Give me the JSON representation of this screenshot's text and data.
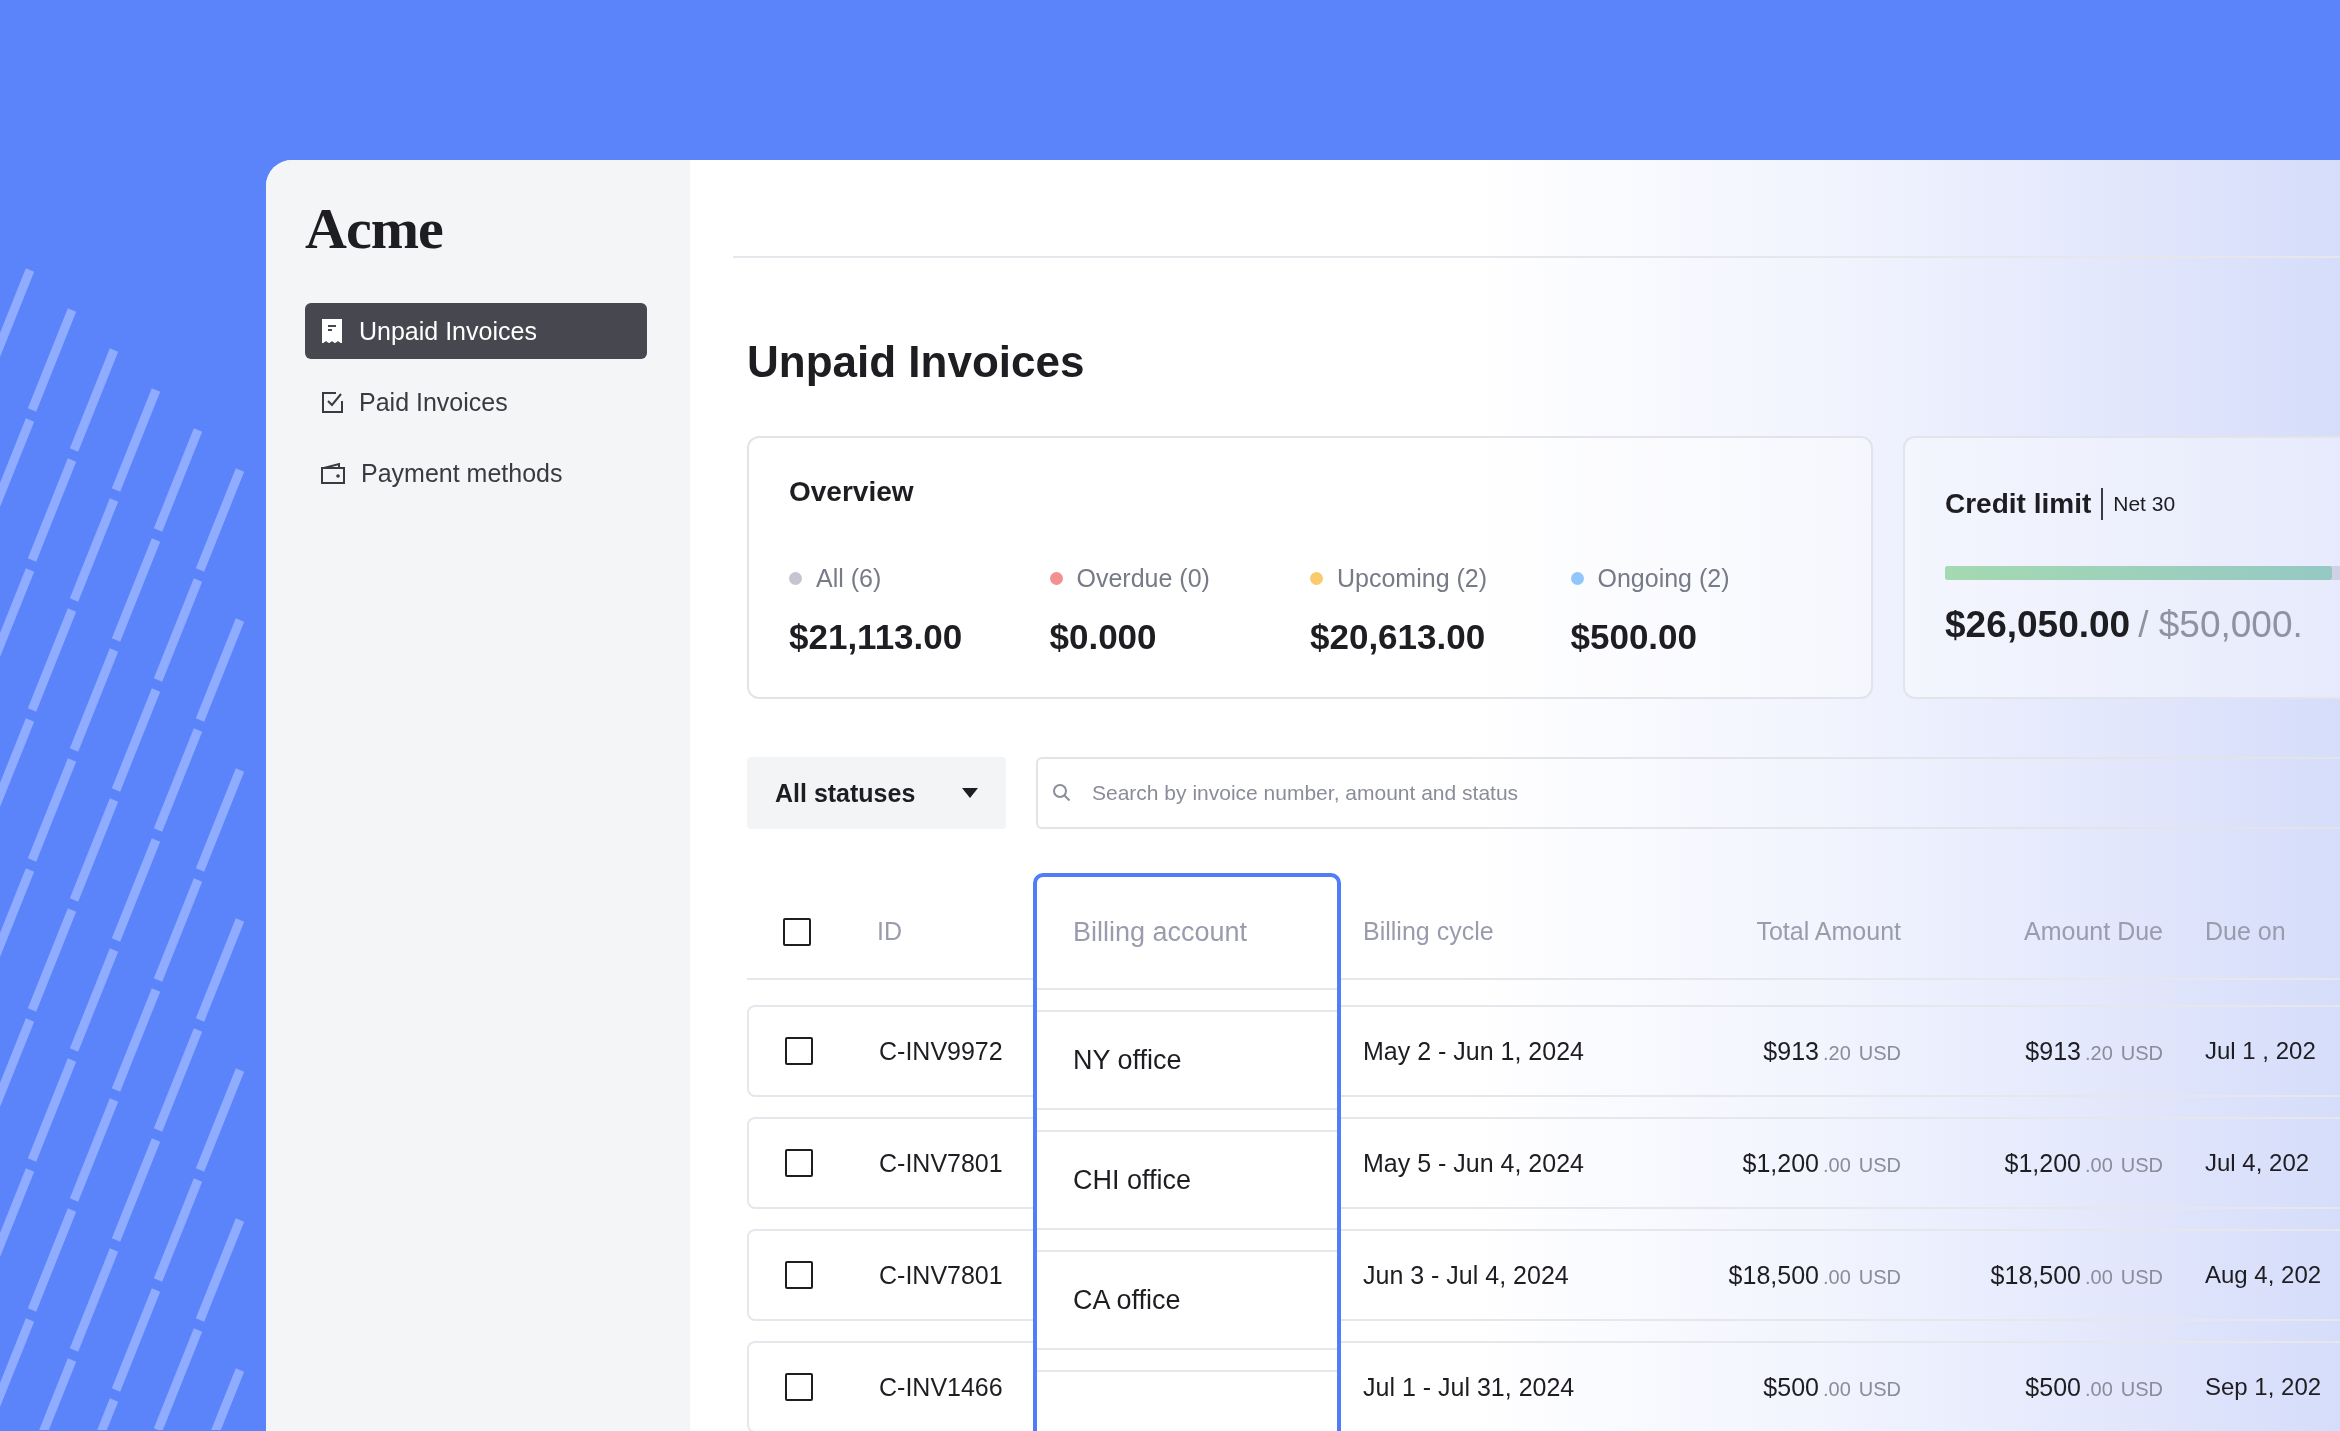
{
  "brand": {
    "name": "Acme"
  },
  "sidebar": {
    "items": [
      {
        "label": "Unpaid Invoices",
        "kind": "receipt",
        "selected": true
      },
      {
        "label": "Paid Invoices",
        "kind": "check",
        "selected": false
      },
      {
        "label": "Payment methods",
        "kind": "wallet",
        "selected": false
      }
    ]
  },
  "page": {
    "title": "Unpaid Invoices"
  },
  "overview": {
    "title": "Overview",
    "stats": [
      {
        "label": "All (6)",
        "value": "$21,113.00",
        "color": "#c4c5d0"
      },
      {
        "label": "Overdue (0)",
        "value": "$0.000",
        "color": "#f29191"
      },
      {
        "label": "Upcoming (2)",
        "value": "$20,613.00",
        "color": "#fbc96e"
      },
      {
        "label": "Ongoing (2)",
        "value": "$500.00",
        "color": "#90c6fa"
      }
    ]
  },
  "credit": {
    "title": "Credit limit",
    "terms": "Net 30",
    "level": 0.52,
    "used": "$26,050.00",
    "limit": "/ $50,000."
  },
  "filter": {
    "value": "All statuses"
  },
  "search": {
    "placeholder": "Search by invoice number, amount and status"
  },
  "table": {
    "header_checked": false,
    "columns": [
      "ID",
      "Billing account",
      "Billing cycle",
      "Total Amount",
      "Amount Due",
      "Due on"
    ],
    "rows": [
      {
        "checked": false,
        "id": "C-INV9972",
        "account": "NY office",
        "cycle": "May 2 - Jun 1, 2024",
        "total": {
          "amount": "$913",
          "cents": ".20",
          "currency": "USD"
        },
        "due": {
          "amount": "$913",
          "cents": ".20",
          "currency": "USD"
        },
        "due_on": "Jul 1 , 202"
      },
      {
        "checked": false,
        "id": "C-INV7801",
        "account": "CHI office",
        "cycle": "May 5 - Jun 4, 2024",
        "total": {
          "amount": "$1,200",
          "cents": ".00",
          "currency": "USD"
        },
        "due": {
          "amount": "$1,200",
          "cents": ".00",
          "currency": "USD"
        },
        "due_on": "Jul 4, 202"
      },
      {
        "checked": false,
        "id": "C-INV7801",
        "account": "CA office",
        "cycle": "Jun 3 - Jul 4, 2024",
        "total": {
          "amount": "$18,500",
          "cents": ".00",
          "currency": "USD"
        },
        "due": {
          "amount": "$18,500",
          "cents": ".00",
          "currency": "USD"
        },
        "due_on": "Aug 4, 202"
      },
      {
        "checked": false,
        "id": "C-INV1466",
        "cycle": "Jul 1 - Jul 31, 2024",
        "total": {
          "amount": "$500",
          "cents": ".00",
          "currency": "USD"
        },
        "due": {
          "amount": "$500",
          "cents": ".00",
          "currency": "USD"
        },
        "due_on": "Sep 1, 202"
      }
    ]
  }
}
